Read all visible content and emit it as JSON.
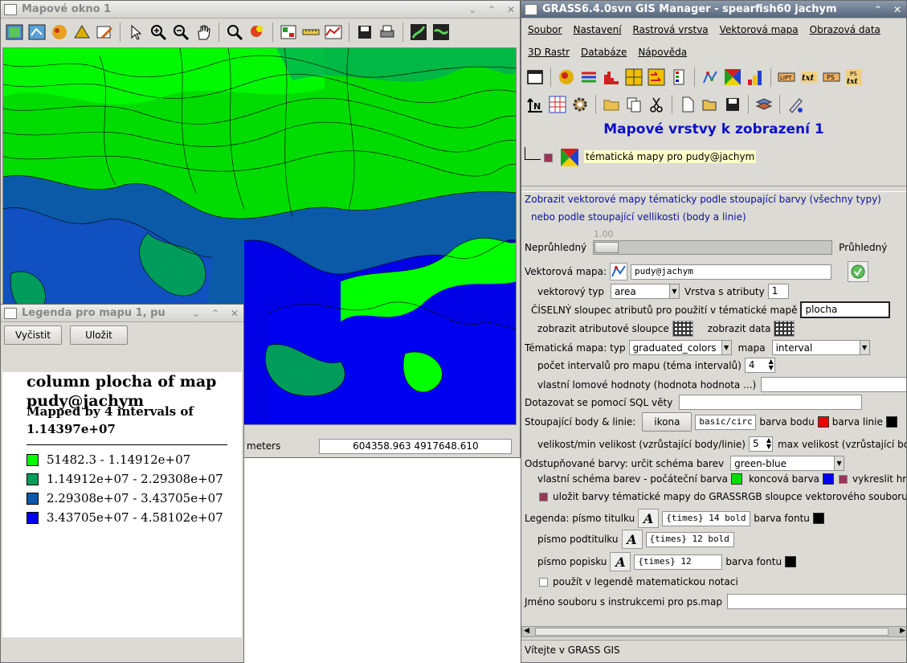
{
  "map_window": {
    "title": "Mapové okno 1",
    "status_units": "meters",
    "status_coords": "604358.963 4917648.610"
  },
  "legend_window": {
    "title": "Legenda pro mapu 1, pu",
    "clear_button": "Vyčistit",
    "save_button": "Uložit",
    "heading": "column plocha of map pudy@jachym",
    "subheading": "Mapped by 4 intervals of 1.14397e+07",
    "items": [
      {
        "label": "51482.3 - 1.14912e+07",
        "color": "#00ff00"
      },
      {
        "label": "1.14912e+07 - 2.29308e+07",
        "color": "#009c5c"
      },
      {
        "label": "2.29308e+07 - 3.43705e+07",
        "color": "#0a5aa8"
      },
      {
        "label": "3.43705e+07 - 4.58102e+07",
        "color": "#0000f0"
      }
    ]
  },
  "manager": {
    "title": "GRASS6.4.0svn GIS Manager - spearfish60 jachym",
    "menu": [
      "Soubor",
      "Nastavení",
      "Rastrová vrstva",
      "Vektorová mapa",
      "Obrazová data",
      "3D Rastr",
      "Databáze",
      "Nápověda"
    ],
    "panel_title": "Mapové vrstvy k zobrazení 1",
    "layer_label": "tématická mapy pro pudy@jachym",
    "description_line1": "Zobrazit vektorové mapy tématicky podle stoupající barvy (všechny typy)",
    "description_line2": "nebo podle stoupající vellikosti (body a linie)",
    "opacity_value": "1.00",
    "opaque_label": "Neprůhledný",
    "transparent_label": "Průhledný",
    "vector_map_label": "Vektorová mapa:",
    "vector_map_value": "pudy@jachym",
    "vector_type_label": "vektorový typ",
    "vector_type_value": "area",
    "layer_attr_label": "Vrstva s atributy",
    "layer_attr_value": "1",
    "numeric_col_label": "ČÍSELNÝ sloupec atributů pro použití v tématické mapě",
    "numeric_col_value": "plocha",
    "show_attr_cols_label": "zobrazit atributové sloupce",
    "show_data_label": "zobrazit data",
    "thematic_type_label": "Tématická mapa: typ",
    "thematic_type_value": "graduated_colors",
    "map_label": "mapa",
    "map_value": "interval",
    "intervals_label": "počet intervalů pro mapu (téma intervalů)",
    "intervals_value": "4",
    "breakpoints_label": "vlastní lomové hodnoty (hodnota hodnota ...)",
    "sql_label": "Dotazovat se pomocí SQL věty",
    "points_label": "Stoupající body & linie:",
    "icon_button": "ikona",
    "icon_value": "basic/circ",
    "point_color_label": "barva bodu",
    "point_color": "#e80000",
    "line_color_label": "barva linie",
    "line_color": "#000000",
    "size_label": "velikost/min velikost (vzrůstající body/linie)",
    "size_value": "5",
    "max_size_label": "max velikost (vzrůstající body)",
    "graduated_colors_label": "Odstupňované barvy: určit schéma barev",
    "color_scheme_value": "green-blue",
    "custom_scheme_label": "vlastní schéma barev - počáteční barva",
    "start_color": "#00e000",
    "end_color_label": "koncová barva",
    "end_color": "#0000f0",
    "draw_border_label": "vykreslit hranic",
    "save_colors_label": "uložit barvy tématické mapy do GRASSRGB sloupce vektorového souboru",
    "legend_title_font_label": "Legenda: písmo titulku",
    "legend_title_font_value": "{times} 14 bold",
    "font_color_label": "barva fontu",
    "subtitle_font_label": "písmo podtitulku",
    "subtitle_font_value": "{times} 12 bold",
    "label_font_label": "písmo popisku",
    "label_font_value": "{times} 12",
    "math_notation_label": "použít v legendě matematickou notaci",
    "psmap_label": "Jméno souboru s instrukcemi pro ps.map",
    "status": "Vítejte v GRASS GIS"
  }
}
